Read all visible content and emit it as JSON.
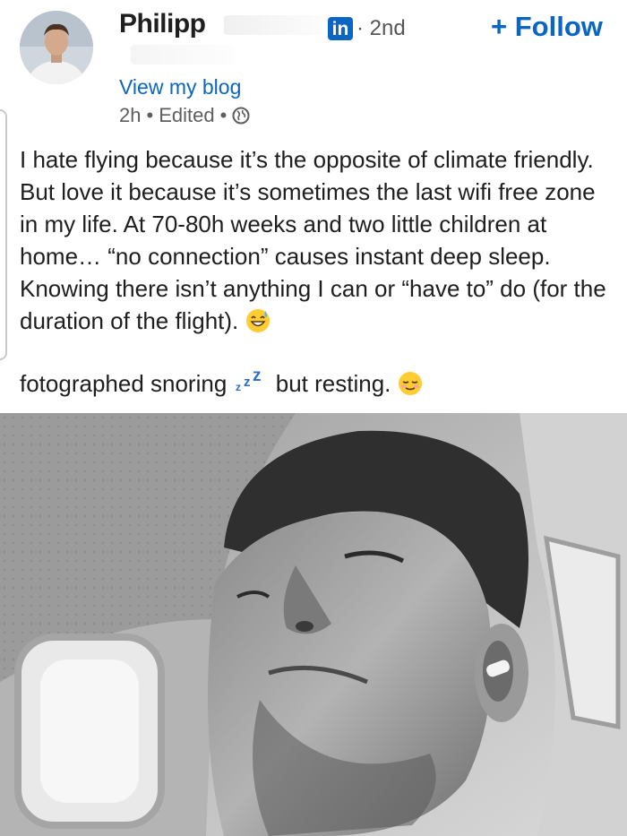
{
  "author": {
    "name": "Philipp",
    "network_badge": "in",
    "degree": "· 2nd",
    "follow_label": "+ Follow",
    "blog_link": "View my blog",
    "timestamp": "2h",
    "edited": "Edited"
  },
  "post": {
    "paragraph_1": "I hate flying because it’s the opposite of climate friendly. But love it because it’s sometimes the last wifi free zone in my life. At 70-80h weeks and two little children at home… “no connection” causes instant deep sleep. Knowing there isn’t anything I can or “have to” do (for the duration of the flight).",
    "paragraph_2_a": "fotographed snoring",
    "paragraph_2_sleep": "zzZ",
    "paragraph_2_b": "but resting."
  },
  "icons": {
    "globe": "globe-icon",
    "emoji_1": "grinning-sweat-emoji",
    "emoji_2": "relieved-face-emoji",
    "sleep": "zzz-sleeping-symbol"
  },
  "colors": {
    "accent": "#0a66c2",
    "text": "#1e1e1e",
    "muted": "#5e5e5e"
  }
}
